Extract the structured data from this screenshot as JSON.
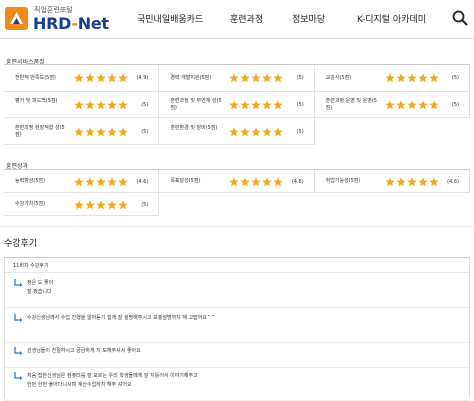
{
  "header": {
    "logo_tag": "직업훈련포털",
    "logo_name_left": "HRD",
    "logo_name_dash": "-",
    "logo_name_right": "Net",
    "nav": [
      "국민내일배움카드",
      "훈련과정",
      "정보마당",
      "K-디지털 아카데미"
    ],
    "search_icon": "search-icon"
  },
  "service_section": {
    "title": "훈련서비스품질",
    "rows": [
      [
        {
          "label": "전반적 만족도(5점)",
          "stars": 5,
          "score": "(4.9)"
        },
        {
          "label": "경력 개발지원(5점)",
          "stars": 5,
          "score": "(5)"
        },
        {
          "label": "교강사(5점)",
          "stars": 5,
          "score": "(5)"
        }
      ],
      [
        {
          "label": "평가 및 피드백(5점)",
          "stars": 5,
          "score": "(5)"
        },
        {
          "label": "훈련과정 및 부연계 성(5점)",
          "stars": 5,
          "score": "(5)"
        },
        {
          "label": "훈련과정 운영 및 운영(5점)",
          "stars": 5,
          "score": "(5)"
        }
      ],
      [
        {
          "label": "훈련과정 현장적합 성(5점)",
          "stars": 5,
          "score": "(5)"
        },
        {
          "label": "훈련환경 및 장비(5점)",
          "stars": 5,
          "score": "(5)"
        }
      ]
    ]
  },
  "outcome_section": {
    "title": "훈련성과",
    "rows": [
      [
        {
          "label": "능력향상(5점)",
          "stars": 5,
          "score": "(4.6)"
        },
        {
          "label": "목표달성(5점)",
          "stars": 5,
          "score": "(4.6)"
        },
        {
          "label": "취업가능성(5점)",
          "stars": 5,
          "score": "(4.6)"
        }
      ],
      [
        {
          "label": "수강가치(5점)",
          "stars": 5,
          "score": "(5)"
        }
      ]
    ]
  },
  "reviews": {
    "heading": "수강후기",
    "count_label": "11회차 수강후기",
    "items": [
      {
        "lines": [
          "정은 도 좋이",
          "잘 봤습니다"
        ]
      },
      {
        "lines": [
          "수강신생님께서 수업 진행을 알아듣기 쉽게 잘 설명해주시고 보충설명까지 해 고맙어요^^"
        ]
      },
      {
        "lines": [
          "선생님들이 친절하시고 궁금하게 지 도해주셔서 좋아요"
        ]
      },
      {
        "lines": [
          "처음 접한신생님은 컴퓨터를 잘 모르는 우리 학생들에게 잘 지틀어서 이야기해주고",
          "한번 한번 풀어다니시며 계산수업하지 해주 셔어요"
        ]
      }
    ]
  },
  "colors": {
    "star": "#f2a91e",
    "logo_blue": "#1b3d8f",
    "logo_orange": "#f08a1c",
    "reply_arrow": "#3a78c8"
  }
}
